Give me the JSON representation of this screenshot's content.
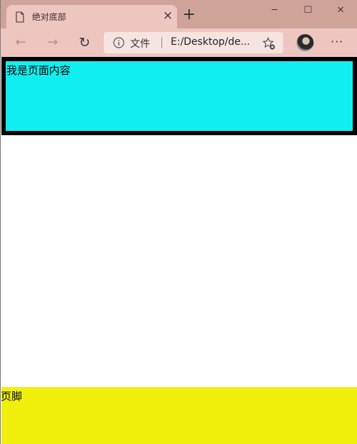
{
  "tab": {
    "title": "绝对底部",
    "close_glyph": "×"
  },
  "new_tab_glyph": "+",
  "window_controls": {
    "minimize": "─",
    "maximize": "☐",
    "close": "✕"
  },
  "toolbar": {
    "back_glyph": "←",
    "forward_glyph": "→",
    "reload_glyph": "↻",
    "menu_glyph": "···"
  },
  "address": {
    "scheme_label": "文件",
    "url": "E:/Desktop/de..."
  },
  "page": {
    "content_text": "我是页面内容",
    "footer_text": "页脚",
    "content_bg": "#10eff0",
    "footer_bg": "#f1ef0c"
  }
}
